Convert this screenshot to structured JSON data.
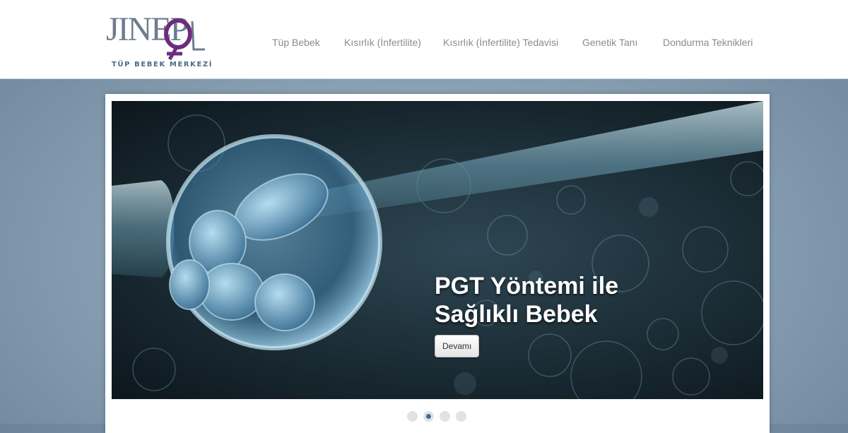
{
  "brand": {
    "name": "JİNEPOL",
    "tagline": "TÜP BEBEK MERKEZİ",
    "accent_color": "#6b2d7e"
  },
  "nav": {
    "items": [
      {
        "label": "Tüp Bebek"
      },
      {
        "label": "Kısırlık (İnfertilite)"
      },
      {
        "label": "Kısırlık (İnfertilite) Tedavisi"
      },
      {
        "label": "Genetik Tanı"
      },
      {
        "label": "Dondurma Teknikleri"
      }
    ]
  },
  "slider": {
    "caption_line1": "PGT Yöntemi ile",
    "caption_line2": "Sağlıklı Bebek",
    "button_label": "Devamı",
    "image": "embryo-microinjection",
    "slide_count": 4,
    "active_slide": 2
  }
}
